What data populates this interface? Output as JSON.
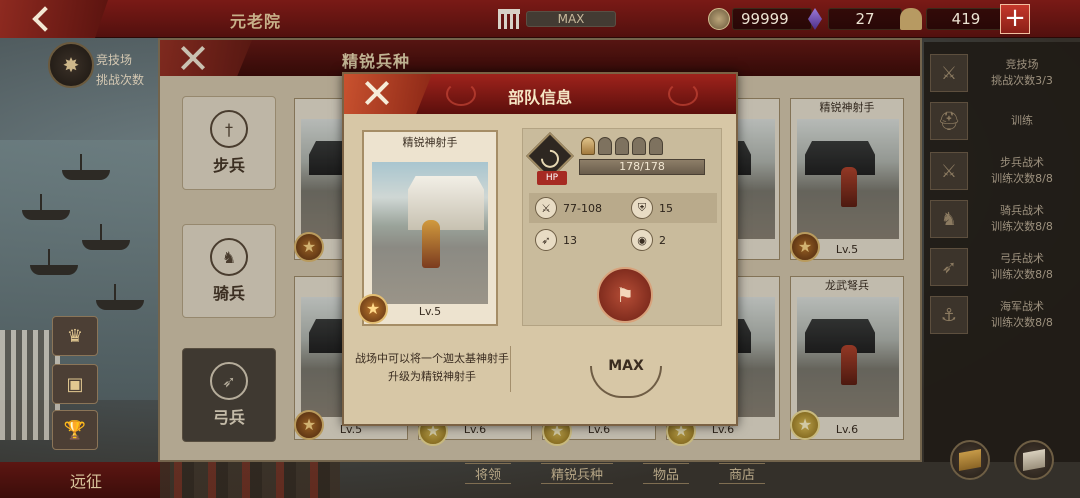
{
  "topbar": {
    "title": "元老院",
    "bank_level": "MAX",
    "coins": "99999",
    "gems": "27",
    "troops": "419",
    "plus_label": "+"
  },
  "left": {
    "arena_label": "竞技场",
    "arena_sub": "挑战次数",
    "expedition": "远征"
  },
  "right_panel": {
    "items": [
      {
        "title": "竞技场",
        "sub": "挑战次数3/3",
        "icon": "crossed-swords-icon"
      },
      {
        "title": "训练",
        "sub": "",
        "icon": "helmet-icon"
      },
      {
        "title": "步兵战术",
        "sub": "训练次数8/8",
        "icon": "sword-icon"
      },
      {
        "title": "骑兵战术",
        "sub": "训练次数8/8",
        "icon": "horse-icon"
      },
      {
        "title": "弓兵战术",
        "sub": "训练次数8/8",
        "icon": "bow-icon"
      },
      {
        "title": "海军战术",
        "sub": "训练次数8/8",
        "icon": "anchor-icon"
      }
    ]
  },
  "elite": {
    "title": "精锐兵种",
    "categories": [
      {
        "label": "步兵",
        "icon": "sword-icon",
        "active": false
      },
      {
        "label": "骑兵",
        "icon": "horse-icon",
        "active": false
      },
      {
        "label": "弓兵",
        "icon": "bow-icon",
        "active": true
      }
    ],
    "cards": [
      {
        "title": "精",
        "level": "Lv.5"
      },
      {
        "title": "手",
        "level": "Lv.6"
      },
      {
        "title": "精锐神射手",
        "level": "Lv.5"
      },
      {
        "title": "精",
        "level": "Lv.5"
      },
      {
        "title": "",
        "level": "Lv.6"
      },
      {
        "title": "",
        "level": "Lv.6"
      },
      {
        "title": "兵",
        "level": "Lv.6"
      },
      {
        "title": "龙武弩兵",
        "level": "Lv.6"
      }
    ],
    "bottom_tabs": [
      "将领",
      "精锐兵种",
      "物品",
      "商店"
    ]
  },
  "troop_info": {
    "title": "部队信息",
    "unit_name": "精锐神射手",
    "unit_level": "Lv.5",
    "hp_label": "HP",
    "hp": "178/178",
    "helmets_total": 5,
    "helmets_on": 1,
    "attack": "77-108",
    "defense": "15",
    "range": "13",
    "vision": "2",
    "description": "战场中可以将一个迦太基神射手升级为精锐神射手",
    "max_label": "MAX"
  }
}
